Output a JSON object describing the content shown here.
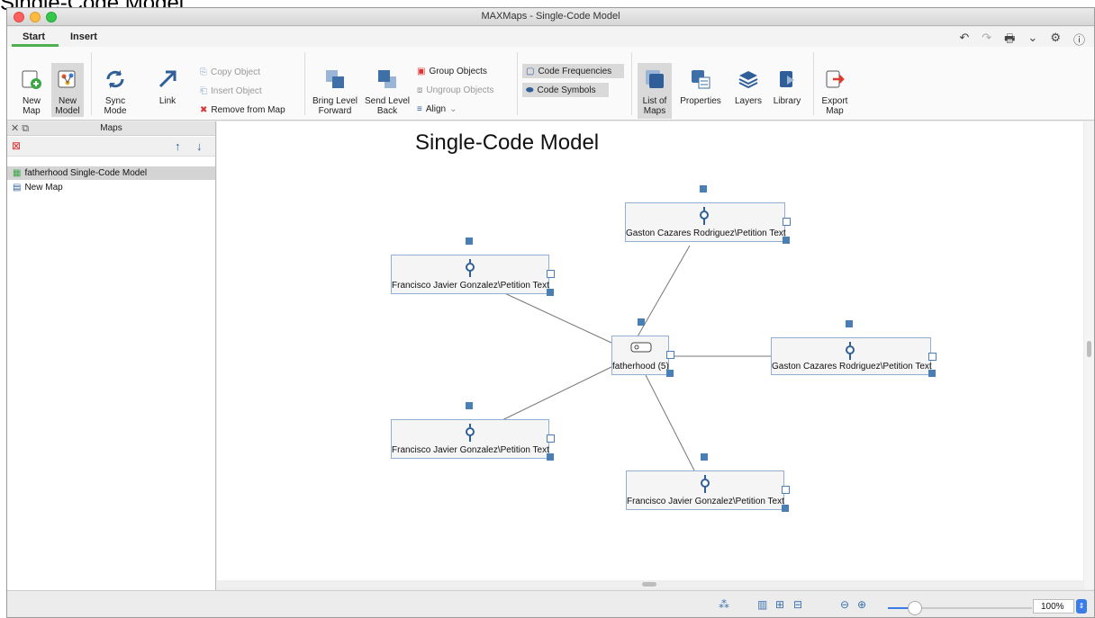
{
  "caption": "Single-Code Model",
  "window": {
    "title": "MAXMaps - Single-Code Model"
  },
  "tabs": [
    {
      "label": "Start"
    },
    {
      "label": "Insert"
    }
  ],
  "ribbon": {
    "new_map": "New\nMap",
    "new_model": "New\nModel",
    "sync_mode": "Sync\nMode",
    "link": "Link",
    "copy_object": "Copy Object",
    "insert_object": "Insert Object",
    "remove_from_map": "Remove from Map",
    "bring_level_forward": "Bring Level\nForward",
    "send_level_back": "Send Level\nBack",
    "group_objects": "Group Objects",
    "ungroup_objects": "Ungroup Objects",
    "align": "Align",
    "code_frequencies": "Code Frequencies",
    "code_symbols": "Code Symbols",
    "list_of_maps": "List of\nMaps",
    "properties": "Properties",
    "layers": "Layers",
    "library": "Library",
    "export_map": "Export\nMap"
  },
  "sidebar": {
    "title": "Maps",
    "items": [
      {
        "label": "fatherhood Single-Code Model",
        "selected": true
      },
      {
        "label": "New Map",
        "selected": false
      }
    ]
  },
  "map": {
    "title": "Single-Code Model",
    "center": {
      "label": "fatherhood (5)"
    },
    "nodes": [
      {
        "label": "Gaston Cazares Rodriguez\\Petition Text"
      },
      {
        "label": "Francisco Javier Gonzalez\\Petition Text"
      },
      {
        "label": "Gaston Cazares Rodriguez\\Petition Text"
      },
      {
        "label": "Francisco Javier Gonzalez\\Petition Text"
      },
      {
        "label": "Francisco Javier Gonzalez\\Petition Text"
      }
    ]
  },
  "status": {
    "zoom": "100%"
  },
  "colors": {
    "accent": "#4a7fb5",
    "tab_underline": "#4caf50",
    "slider": "#3b7de8"
  }
}
